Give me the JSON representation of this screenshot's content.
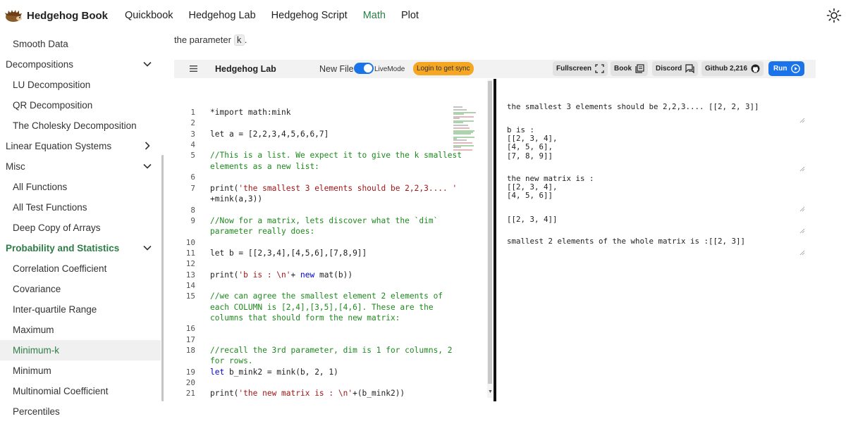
{
  "nav": {
    "brand": "Hedgehog Book",
    "links": [
      "Quickbook",
      "Hedgehog Lab",
      "Hedgehog Script",
      "Math",
      "Plot"
    ],
    "active": "Math"
  },
  "sidebar": {
    "items": [
      {
        "label": "Smooth Data",
        "kind": "child"
      },
      {
        "label": "Decompositions",
        "kind": "group",
        "chevron": "down"
      },
      {
        "label": "LU Decomposition",
        "kind": "child"
      },
      {
        "label": "QR Decomposition",
        "kind": "child"
      },
      {
        "label": "The Cholesky Decomposition",
        "kind": "child"
      },
      {
        "label": "Linear Equation Systems",
        "kind": "group",
        "chevron": "right"
      },
      {
        "label": "Misc",
        "kind": "group",
        "chevron": "down"
      },
      {
        "label": "All Functions",
        "kind": "child"
      },
      {
        "label": "All Test Functions",
        "kind": "child"
      },
      {
        "label": "Deep Copy of Arrays",
        "kind": "child"
      },
      {
        "label": "Probability and Statistics",
        "kind": "group-accent",
        "chevron": "down"
      },
      {
        "label": "Correlation Coefficient",
        "kind": "child"
      },
      {
        "label": "Covariance",
        "kind": "child"
      },
      {
        "label": "Inter-quartile Range",
        "kind": "child"
      },
      {
        "label": "Maximum",
        "kind": "child"
      },
      {
        "label": "Minimum-k",
        "kind": "child-selected"
      },
      {
        "label": "Minimum",
        "kind": "child"
      },
      {
        "label": "Multinomial Coefficient",
        "kind": "child"
      },
      {
        "label": "Percentiles",
        "kind": "child"
      }
    ]
  },
  "intro": {
    "prefix": "the parameter ",
    "code": "k",
    "suffix": "."
  },
  "lab": {
    "title": "Hedgehog Lab",
    "new_file": "New File",
    "livemode": "LiveMode",
    "livemode_on": true,
    "login": "Login to get sync",
    "buttons": {
      "fullscreen": "Fullscreen",
      "book": "Book",
      "discord": "Discord",
      "github": "Github 2,216",
      "run": "Run"
    }
  },
  "editor": {
    "line_numbers": [
      "1",
      "2",
      "3",
      "4",
      "5",
      "",
      "6",
      "7",
      "",
      "8",
      "9",
      "",
      "10",
      "11",
      "12",
      "13",
      "14",
      "15",
      "",
      "",
      "16",
      "17",
      "18",
      "",
      "19",
      "20",
      "21"
    ],
    "lines": [
      {
        "parts": [
          [
            "",
            "*import math:mink"
          ]
        ]
      },
      {
        "parts": []
      },
      {
        "parts": [
          [
            "",
            "let a = [2,2,3,4,5,6,6,7]"
          ]
        ]
      },
      {
        "parts": []
      },
      {
        "parts": [
          [
            "cm",
            "//This is a list. We expect it to give the k smallest"
          ]
        ]
      },
      {
        "parts": [
          [
            "cm",
            "elements as a new list:"
          ]
        ]
      },
      {
        "parts": []
      },
      {
        "parts": [
          [
            "",
            "print("
          ],
          [
            "st",
            "'the smallest 3 elements should be 2,2,3.... '"
          ]
        ]
      },
      {
        "parts": [
          [
            "",
            "+mink(a,3))"
          ]
        ]
      },
      {
        "parts": []
      },
      {
        "parts": [
          [
            "cm",
            "//Now for a matrix, lets discover what the `dim`"
          ]
        ]
      },
      {
        "parts": [
          [
            "cm",
            "parameter really does:"
          ]
        ]
      },
      {
        "parts": []
      },
      {
        "parts": [
          [
            "",
            "let b = [[2,3,4],[4,5,6],[7,8,9]]"
          ]
        ]
      },
      {
        "parts": []
      },
      {
        "parts": [
          [
            "",
            "print("
          ],
          [
            "st",
            "'b is : \\n'"
          ],
          [
            "",
            "+ "
          ],
          [
            "kw",
            "new"
          ],
          [
            "",
            " mat(b))"
          ]
        ]
      },
      {
        "parts": []
      },
      {
        "parts": [
          [
            "cm",
            "//we can agree the smallest element 2 elements of"
          ]
        ]
      },
      {
        "parts": [
          [
            "cm",
            "each COLUMN is [2,4],[3,5],[4,6]. These are the"
          ]
        ]
      },
      {
        "parts": [
          [
            "cm",
            "columns that should form the new matrix:"
          ]
        ]
      },
      {
        "parts": []
      },
      {
        "parts": []
      },
      {
        "parts": [
          [
            "cm",
            "//recall the 3rd parameter, dim is 1 for columns, 2"
          ]
        ]
      },
      {
        "parts": [
          [
            "cm",
            "for rows."
          ]
        ]
      },
      {
        "parts": [
          [
            "kw",
            "let"
          ],
          [
            "",
            " b_mink2 = mink(b, 2, 1)"
          ]
        ]
      },
      {
        "parts": []
      },
      {
        "parts": [
          [
            "",
            "print("
          ],
          [
            "st",
            "'the new matrix is : \\n'"
          ],
          [
            "",
            "+(b_mink2))"
          ]
        ]
      }
    ]
  },
  "output": {
    "blocks": [
      "the smallest 3 elements should be 2,2,3.... [[2, 2, 3]]",
      "b is :\n[[2, 3, 4],\n[4, 5, 6],\n[7, 8, 9]]",
      "the new matrix is :\n[[2, 3, 4],\n[4, 5, 6]]",
      "[[2, 3, 4]]",
      "smallest 2 elements of the whole matrix is :[[2, 3]]"
    ]
  },
  "colors": {
    "accent": "#2e7d46",
    "primary": "#1a73e8",
    "login": "#f5a623"
  }
}
